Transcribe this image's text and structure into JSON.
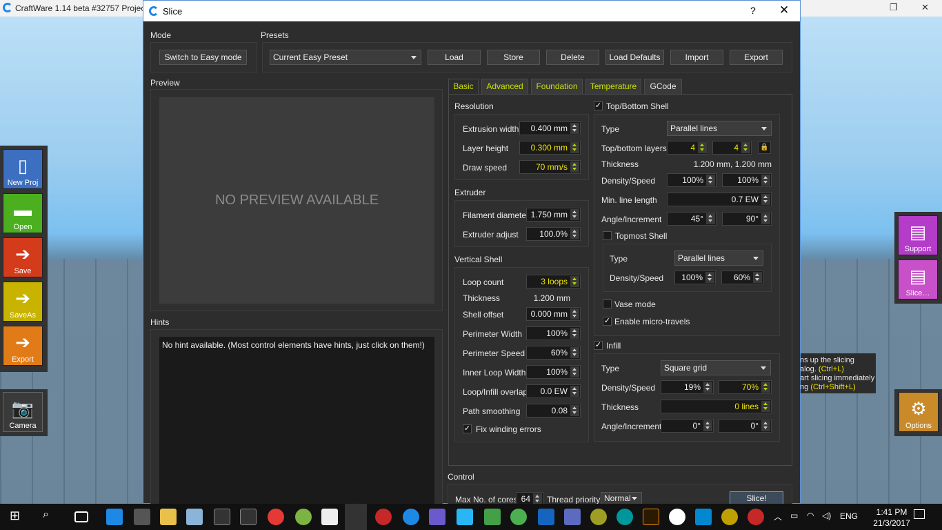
{
  "background": {
    "app_title": "CraftWare 1.14 beta #32757   Projec",
    "left_tools": [
      {
        "label": "New Proj",
        "icon": "new-project-icon",
        "color": "#3d6fc1"
      },
      {
        "label": "Open",
        "icon": "folder-icon",
        "color": "#4caf20"
      },
      {
        "label": "Save",
        "icon": "save-icon",
        "color": "#d33b1a"
      },
      {
        "label": "SaveAs",
        "icon": "save-as-icon",
        "color": "#c8b400"
      },
      {
        "label": "Export",
        "icon": "export-icon",
        "color": "#e07b18"
      }
    ],
    "camera_label": "Camera",
    "right_tools": [
      {
        "label": "Support",
        "icon": "support-icon",
        "color": "#b43cc8"
      },
      {
        "label": "Slice…",
        "icon": "slice-icon",
        "color": "#c850c8"
      }
    ],
    "options_label": "Options",
    "hint_lines": [
      "ns up the slicing",
      "alog.",
      "(Ctrl+L)",
      "art slicing immediately",
      "ng",
      "(Ctrl+Shift+L)"
    ]
  },
  "dialog": {
    "title": "Slice",
    "help": "?",
    "close": "✕",
    "mode_label": "Mode",
    "switch_button": "Switch to Easy mode",
    "presets_label": "Presets",
    "preset_value": "Current Easy Preset",
    "preset_buttons": [
      "Load",
      "Store",
      "Delete",
      "Load Defaults",
      "Import",
      "Export"
    ],
    "preview_label": "Preview",
    "preview_text": "NO  PREVIEW  AVAILABLE",
    "hints_label": "Hints",
    "hints_text": "No hint available. (Most control elements have hints, just click on them!)",
    "tabs": [
      "Basic",
      "Advanced",
      "Foundation",
      "Temperature",
      "GCode"
    ],
    "resolution": {
      "title": "Resolution",
      "extrusion_width_label": "Extrusion width",
      "extrusion_width": "0.400 mm",
      "layer_height_label": "Layer height",
      "layer_height": "0.300 mm",
      "draw_speed_label": "Draw speed",
      "draw_speed": "70 mm/s"
    },
    "extruder": {
      "title": "Extruder",
      "filament_label": "Filament diameter",
      "filament": "1.750 mm",
      "adjust_label": "Extruder adjust",
      "adjust": "100.0%"
    },
    "vertical_shell": {
      "title": "Vertical Shell",
      "loop_count_label": "Loop count",
      "loop_count": "3 loops",
      "thickness_label": "Thickness",
      "thickness": "1.200 mm",
      "shell_offset_label": "Shell offset",
      "shell_offset": "0.000 mm",
      "perimeter_width_label": "Perimeter Width",
      "perimeter_width": "100%",
      "perimeter_speed_label": "Perimeter Speed",
      "perimeter_speed": "60%",
      "inner_loop_label": "Inner Loop Width",
      "inner_loop": "100%",
      "overlap_label": "Loop/Infill overlap",
      "overlap": "0.0 EW",
      "smoothing_label": "Path smoothing",
      "smoothing": "0.08",
      "fix_winding_label": "Fix winding errors"
    },
    "top_bottom": {
      "title": "Top/Bottom Shell",
      "type_label": "Type",
      "type": "Parallel lines",
      "layers_label": "Top/bottom layers",
      "top_layers": "4",
      "bottom_layers": "4",
      "thickness_label": "Thickness",
      "thickness": "1.200 mm, 1.200 mm",
      "density_label": "Density/Speed",
      "density": "100%",
      "speed": "100%",
      "min_line_label": "Min. line length",
      "min_line": "0.7 EW",
      "angle_label": "Angle/Increment",
      "angle": "45°",
      "increment": "90°",
      "topmost_title": "Topmost Shell",
      "topmost_type_label": "Type",
      "topmost_type": "Parallel lines",
      "topmost_density_label": "Density/Speed",
      "topmost_density": "100%",
      "topmost_speed": "60%",
      "vase_label": "Vase mode",
      "micro_label": "Enable micro-travels"
    },
    "infill": {
      "title": "Infill",
      "type_label": "Type",
      "type": "Square grid",
      "density_label": "Density/Speed",
      "density": "19%",
      "speed": "70%",
      "thickness_label": "Thickness",
      "thickness": "0 lines",
      "angle_label": "Angle/Increment",
      "angle": "0°",
      "increment": "0°"
    },
    "control": {
      "title": "Control",
      "cores_label": "Max No. of cores",
      "cores": "64",
      "priority_label": "Thread priority",
      "priority": "Normal",
      "slice_button": "Slice!"
    }
  },
  "taskbar": {
    "language": "ENG",
    "time": "1:41 PM",
    "date": "21/3/2017"
  }
}
